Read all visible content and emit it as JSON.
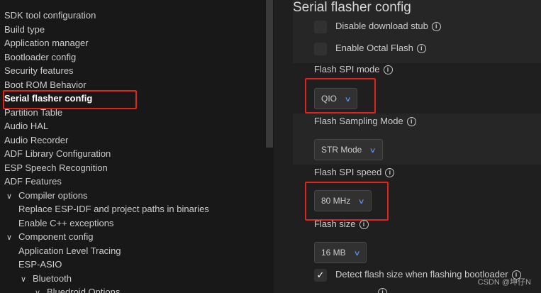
{
  "tree": {
    "items": [
      {
        "label": "SDK tool configuration",
        "indent": 0,
        "chevron": ""
      },
      {
        "label": "Build type",
        "indent": 0,
        "chevron": ""
      },
      {
        "label": "Application manager",
        "indent": 0,
        "chevron": ""
      },
      {
        "label": "Bootloader config",
        "indent": 0,
        "chevron": ""
      },
      {
        "label": "Security features",
        "indent": 0,
        "chevron": ""
      },
      {
        "label": "Boot ROM Behavior",
        "indent": 0,
        "chevron": ""
      },
      {
        "label": "Serial flasher config",
        "indent": 0,
        "chevron": "",
        "selected": true
      },
      {
        "label": "Partition Table",
        "indent": 0,
        "chevron": ""
      },
      {
        "label": "Audio HAL",
        "indent": 0,
        "chevron": ""
      },
      {
        "label": "Audio Recorder",
        "indent": 0,
        "chevron": ""
      },
      {
        "label": "ADF Library Configuration",
        "indent": 0,
        "chevron": ""
      },
      {
        "label": "ESP Speech Recognition",
        "indent": 0,
        "chevron": ""
      },
      {
        "label": "ADF Features",
        "indent": 0,
        "chevron": ""
      },
      {
        "label": "Compiler options",
        "indent": 0,
        "chevron": "expanded"
      },
      {
        "label": "Replace ESP-IDF and project paths in binaries",
        "indent": 1,
        "chevron": ""
      },
      {
        "label": "Enable C++ exceptions",
        "indent": 1,
        "chevron": ""
      },
      {
        "label": "Component config",
        "indent": 0,
        "chevron": "expanded"
      },
      {
        "label": "Application Level Tracing",
        "indent": 1,
        "chevron": ""
      },
      {
        "label": "ESP-ASIO",
        "indent": 1,
        "chevron": ""
      },
      {
        "label": "Bluetooth",
        "indent": 1,
        "chevron": "expanded"
      },
      {
        "label": "Bluedroid Options",
        "indent": 2,
        "chevron": "expanded"
      }
    ]
  },
  "panel": {
    "title": "Serial flasher config",
    "disable_download_stub": {
      "label": "Disable download stub",
      "checked": false
    },
    "enable_octal_flash": {
      "label": "Enable Octal Flash",
      "checked": false
    },
    "flash_spi_mode": {
      "label": "Flash SPI mode",
      "value": "QIO"
    },
    "flash_sampling_mode": {
      "label": "Flash Sampling Mode",
      "value": "STR Mode"
    },
    "flash_spi_speed": {
      "label": "Flash SPI speed",
      "value": "80 MHz"
    },
    "flash_size": {
      "label": "Flash size",
      "value": "16 MB"
    },
    "detect_flash_size": {
      "label": "Detect flash size when flashing bootloader",
      "checked": true
    }
  },
  "icons": {
    "info": "info-icon",
    "check": "checkmark-icon",
    "chevron_down": "chevron-down-icon",
    "chevron_expanded": "chevron-down-icon"
  },
  "colors": {
    "highlight": "#e0231d",
    "accent": "#5a8ff0"
  },
  "watermark": "CSDN @坤仔N"
}
